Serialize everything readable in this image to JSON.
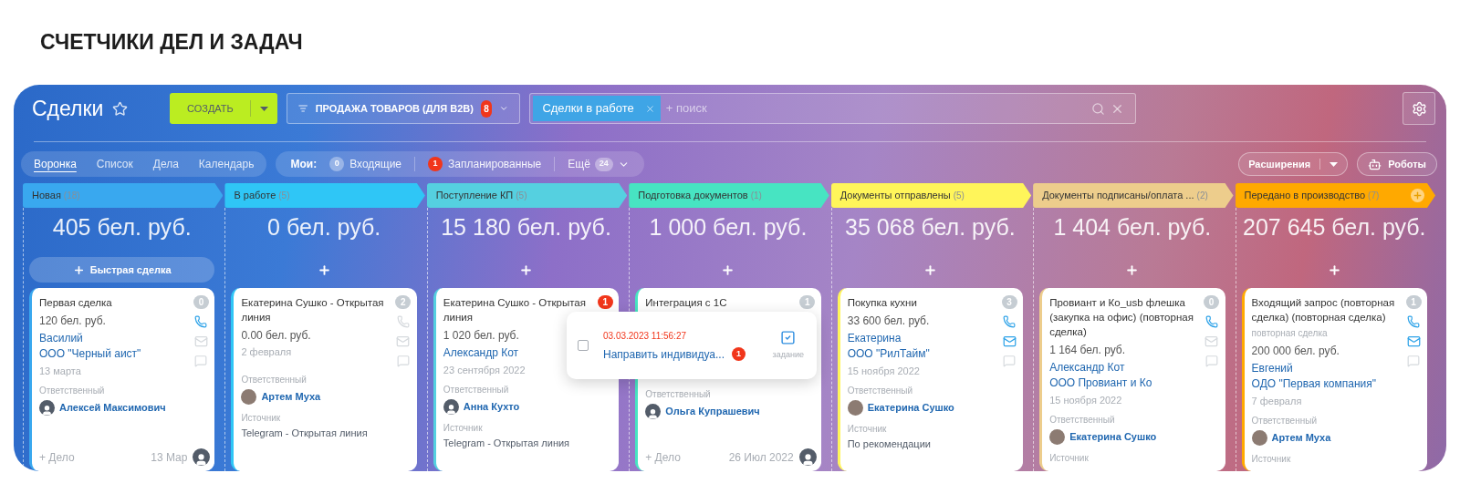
{
  "heading": "СЧЕТЧИКИ ДЕЛ И ЗАДАЧ",
  "toolbar": {
    "title": "Сделки",
    "create_button": "СОЗДАТЬ",
    "pipeline": {
      "label": "ПРОДАЖА ТОВАРОВ (ДЛЯ B2B)",
      "count": "8"
    },
    "filter": {
      "tag": "Сделки в работе",
      "placeholder": "+ поиск"
    }
  },
  "view_tabs": [
    {
      "label": "Воронка",
      "selected": true
    },
    {
      "label": "Список",
      "selected": false
    },
    {
      "label": "Дела",
      "selected": false
    },
    {
      "label": "Календарь",
      "selected": false
    }
  ],
  "counters": {
    "label": "Мои:",
    "items": [
      {
        "count": "0",
        "label": "Входящие",
        "alert": false
      },
      {
        "count": "1",
        "label": "Запланированные",
        "alert": true
      }
    ],
    "more": {
      "label": "Ещё",
      "count": "24"
    }
  },
  "right_buttons": {
    "extensions": "Расширения",
    "robots": "Роботы"
  },
  "stages": [
    {
      "name": "Новая",
      "count": "(18)",
      "color": "#39a8ef",
      "sum": "405 бел. руб.",
      "add_label": "Быстрая сделка",
      "header_add": false,
      "card": {
        "title": "Первая сделка",
        "amount": "120 бел. руб.",
        "contact": "Василий",
        "company": "ООО \"Черный аист\"",
        "date": "13 марта",
        "responsible_label": "Ответственный",
        "responsible": "Алексей Максимович",
        "has_photo": false,
        "counter": "0",
        "counter_alert": false,
        "phone_active": true,
        "mail_active": false,
        "footer": {
          "add": "+ Дело",
          "date": "13 Мар"
        }
      }
    },
    {
      "name": "В работе",
      "count": "(5)",
      "color": "#2fc6f6",
      "sum": "0 бел. руб.",
      "header_add": false,
      "card": {
        "title": "Екатерина Сушко - Открытая линия",
        "amount": "0.00 бел. руб.",
        "date": "2 февраля",
        "responsible_label": "Ответственный",
        "responsible": "Артем Муха",
        "has_photo": true,
        "source_label": "Источник",
        "source": "Telegram - Открытая линия",
        "counter": "2",
        "counter_alert": false,
        "phone_active": false,
        "mail_active": false
      }
    },
    {
      "name": "Поступление КП",
      "count": "(5)",
      "color": "#55d0e0",
      "sum": "15 180 бел. руб.",
      "header_add": false,
      "card": {
        "title": "Екатерина Сушко - Открытая линия",
        "amount": "1 020 бел. руб.",
        "contact": "Александр Кот",
        "date": "23 сентября 2022",
        "responsible_label": "Ответственный",
        "responsible": "Анна Кухто",
        "has_photo": false,
        "source_label": "Источник",
        "source": "Telegram - Открытая линия",
        "counter": "1",
        "counter_alert": true
      }
    },
    {
      "name": "Подготовка документов",
      "count": "(1)",
      "color": "#47e4c2",
      "sum": "1 000 бел. руб.",
      "header_add": false,
      "card": {
        "title": "Интеграция с 1С",
        "responsible_label": "Ответственный",
        "responsible": "Ольга Купрашевич",
        "has_photo": false,
        "counter": "1",
        "counter_alert": false,
        "footer": {
          "add": "+ Дело",
          "date": "26 Июл 2022"
        }
      }
    },
    {
      "name": "Документы отправлены",
      "count": "(5)",
      "color": "#fff55a",
      "sum": "35 068 бел. руб.",
      "header_add": false,
      "card": {
        "title": "Покупка кухни",
        "amount": "33 600 бел. руб.",
        "contact": "Екатерина",
        "company": "ООО \"РилТайм\"",
        "date": "15 ноября 2022",
        "responsible_label": "Ответственный",
        "responsible": "Екатерина Сушко",
        "has_photo": true,
        "source_label": "Источник",
        "source": "По рекомендации",
        "counter": "3",
        "counter_alert": false,
        "phone_active": true,
        "mail_active": true
      }
    },
    {
      "name": "Документы подписаны/оплата ...",
      "count": "(2)",
      "color": "#edcd8c",
      "sum": "1 404 бел. руб.",
      "header_add": false,
      "card": {
        "title": "Провиант и Ко_usb флешка (закупка на офис) (повторная сделка)",
        "amount": "1 164 бел. руб.",
        "contact": "Александр Кот",
        "company": "ООО Провиант и Ко",
        "date": "15 ноября 2022",
        "responsible_label": "Ответственный",
        "responsible": "Екатерина Сушко",
        "has_photo": true,
        "source_label": "Источник",
        "counter": "0",
        "counter_alert": false,
        "phone_active": true,
        "mail_active": false
      }
    },
    {
      "name": "Передано в производство",
      "count": "(7)",
      "color": "#ffa900",
      "sum": "207 645 бел. руб.",
      "header_add": true,
      "card": {
        "title": "Входящий запрос (повторная сделка) (повторная сделка)",
        "subtitle": "повторная сделка",
        "amount": "200 000 бел. руб.",
        "contact": "Евгений",
        "company": "ОДО \"Первая компания\"",
        "date": "7 февраля",
        "responsible_label": "Ответственный",
        "responsible": "Артем Муха",
        "has_photo": true,
        "source_label": "Источник",
        "counter": "1",
        "counter_alert": false,
        "phone_active": true,
        "mail_active": true
      }
    }
  ],
  "task_popup": {
    "checked": false,
    "deadline": "03.03.2023 11:56:27",
    "title": "Направить индивидуа...",
    "count": "1",
    "type_label": "задание"
  }
}
